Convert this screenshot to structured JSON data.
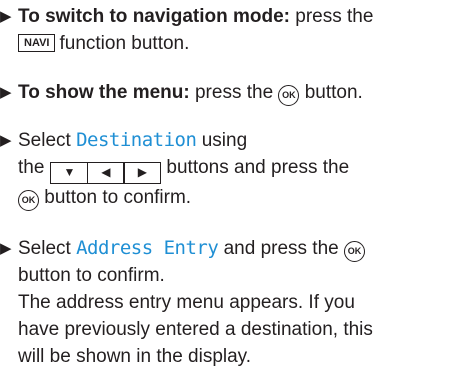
{
  "steps": [
    {
      "bold": "To switch to navigation mode:",
      "text1": " press the",
      "key": "NAVI",
      "text2": "function button."
    },
    {
      "bold": "To show the menu:",
      "text1": " press the ",
      "ok": "OK",
      "text2": " button."
    },
    {
      "text1": "Select ",
      "display": "Destination",
      "text2": " using",
      "text3": "the",
      "arrows": [
        "▼",
        "◀",
        "▶"
      ],
      "text4": "buttons and press the",
      "ok": "OK",
      "text5": " button to confirm."
    },
    {
      "text1": "Select ",
      "display": "Address Entry",
      "text2": " and press the ",
      "ok": "OK",
      "text3": "button to confirm.",
      "text4": "The address entry menu appears. If you",
      "text5": "have previously entered a destination, this",
      "text6": "will be shown in the display."
    }
  ],
  "bullet": "▶"
}
